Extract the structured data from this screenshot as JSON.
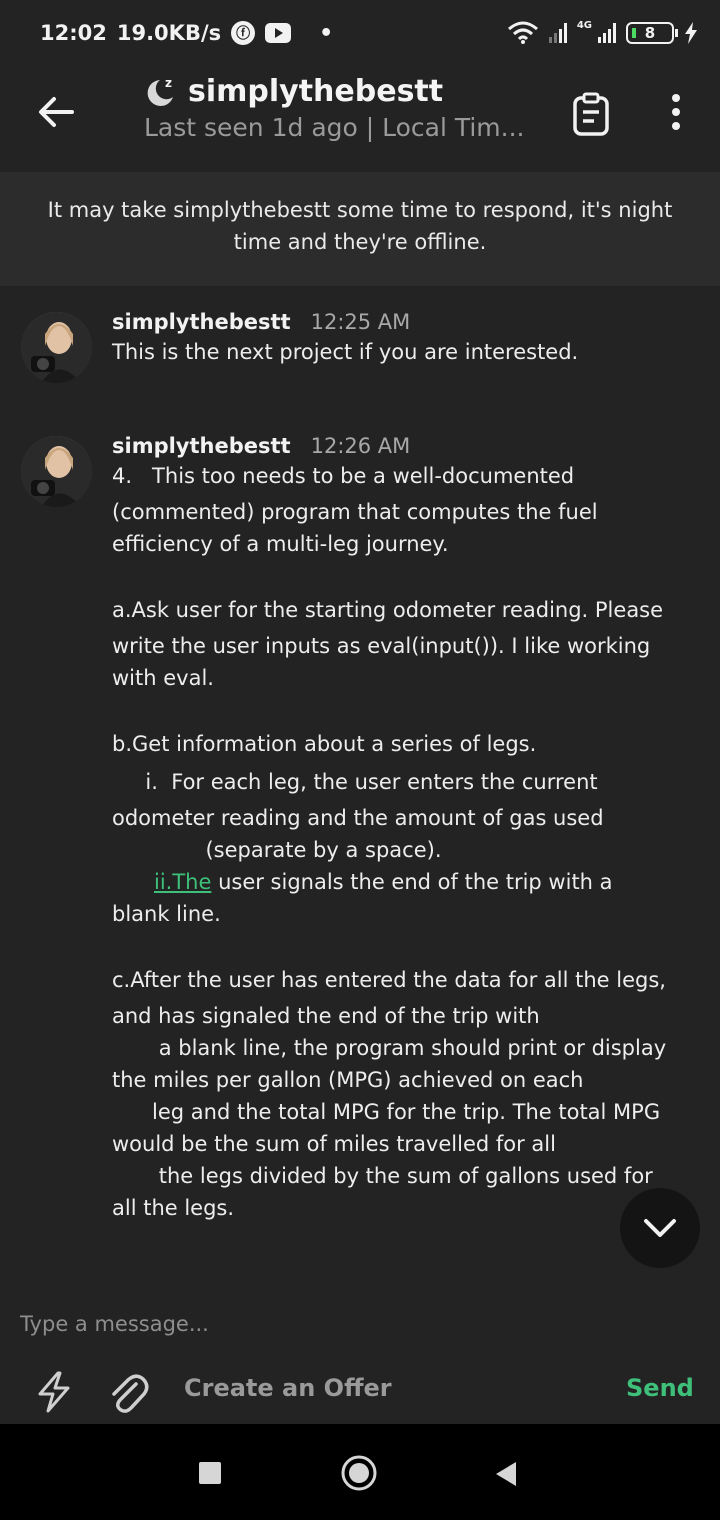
{
  "status_bar": {
    "time": "12:02",
    "speed": "19.0KB/s",
    "network_type": "4G",
    "battery": "8",
    "icons": [
      "notification-badge-icon",
      "youtube-icon",
      "wifi-icon",
      "signal-icon",
      "signal-4g-icon",
      "battery-icon",
      "charging-icon"
    ]
  },
  "header": {
    "username": "simplythebestt",
    "status": "Last seen 1d ago | Local Tim...",
    "icons": [
      "back-arrow-icon",
      "sleep-moon-icon",
      "clipboard-icon",
      "more-vertical-icon"
    ]
  },
  "notice": {
    "text": "It may take simplythebestt some time to respond, it's night time and they're offline."
  },
  "messages": [
    {
      "sender": "simplythebestt",
      "time": "12:25 AM",
      "lines": [
        "This is the next project if you are interested."
      ]
    },
    {
      "sender": "simplythebestt",
      "time": "12:26 AM",
      "lines": [
        "4.   This too needs to be a well-documented",
        "(commented) program that computes the fuel",
        "efficiency of a multi-leg journey.",
        "a.Ask user for the starting odometer reading. Please",
        "write the user inputs as eval(input()). I like working",
        "with eval.",
        "b.Get information about a series of legs.",
        "     i.  For each leg, the user enters the current",
        "odometer reading and the amount of gas used",
        "              (separate by a space).",
        "ii.The",
        " user signals the end of the trip with a",
        "blank line.",
        "c.After the user has entered the data for all the legs,",
        "and has signaled the end of the trip with",
        "       a blank line, the program should print or display",
        "the miles per gallon (MPG) achieved on each",
        "      leg and the total MPG for the trip. The total MPG",
        "would be the sum of miles travelled for all",
        "       the legs divided by the sum of gallons used for",
        "all the legs."
      ]
    }
  ],
  "composer": {
    "placeholder": "Type a message...",
    "offer_label": "Create an Offer",
    "send_label": "Send",
    "icons": [
      "lightning-icon",
      "paperclip-icon"
    ]
  },
  "colors": {
    "background": "#232323",
    "notice_bg": "#2c2c2c",
    "accent_green": "#3ec07a",
    "muted_text": "#9a9a9a"
  },
  "nav_icons": [
    "recents-square-icon",
    "home-circle-icon",
    "back-triangle-icon",
    "scroll-down-chevron-icon"
  ]
}
